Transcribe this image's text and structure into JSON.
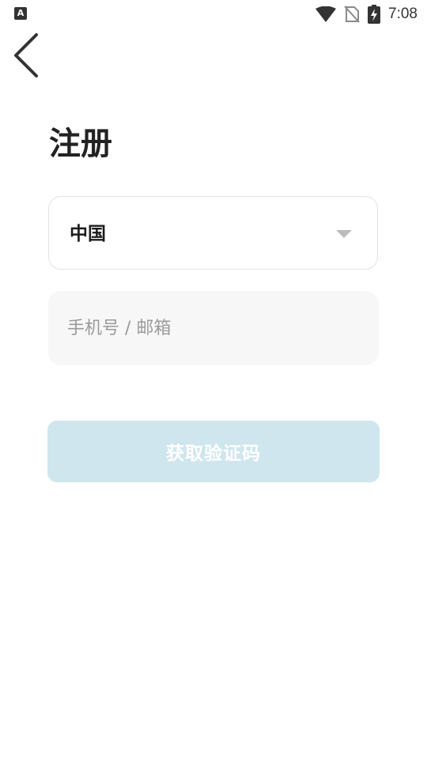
{
  "status_bar": {
    "left_icon_letter": "A",
    "time": "7:08",
    "icons": [
      "wifi-icon",
      "no-sim-icon",
      "battery-charging-icon"
    ]
  },
  "header": {
    "back_icon": "chevron-left-icon"
  },
  "page": {
    "title": "注册"
  },
  "form": {
    "country": {
      "value": "中国",
      "icon": "chevron-down-icon"
    },
    "account": {
      "value": "",
      "placeholder": "手机号 / 邮箱"
    },
    "get_code_label": "获取验证码"
  },
  "colors": {
    "button_disabled_bg": "#cfe6ee",
    "input_bg": "#f7f7f7",
    "select_border": "#e2e2e2",
    "title_text": "#222222"
  }
}
